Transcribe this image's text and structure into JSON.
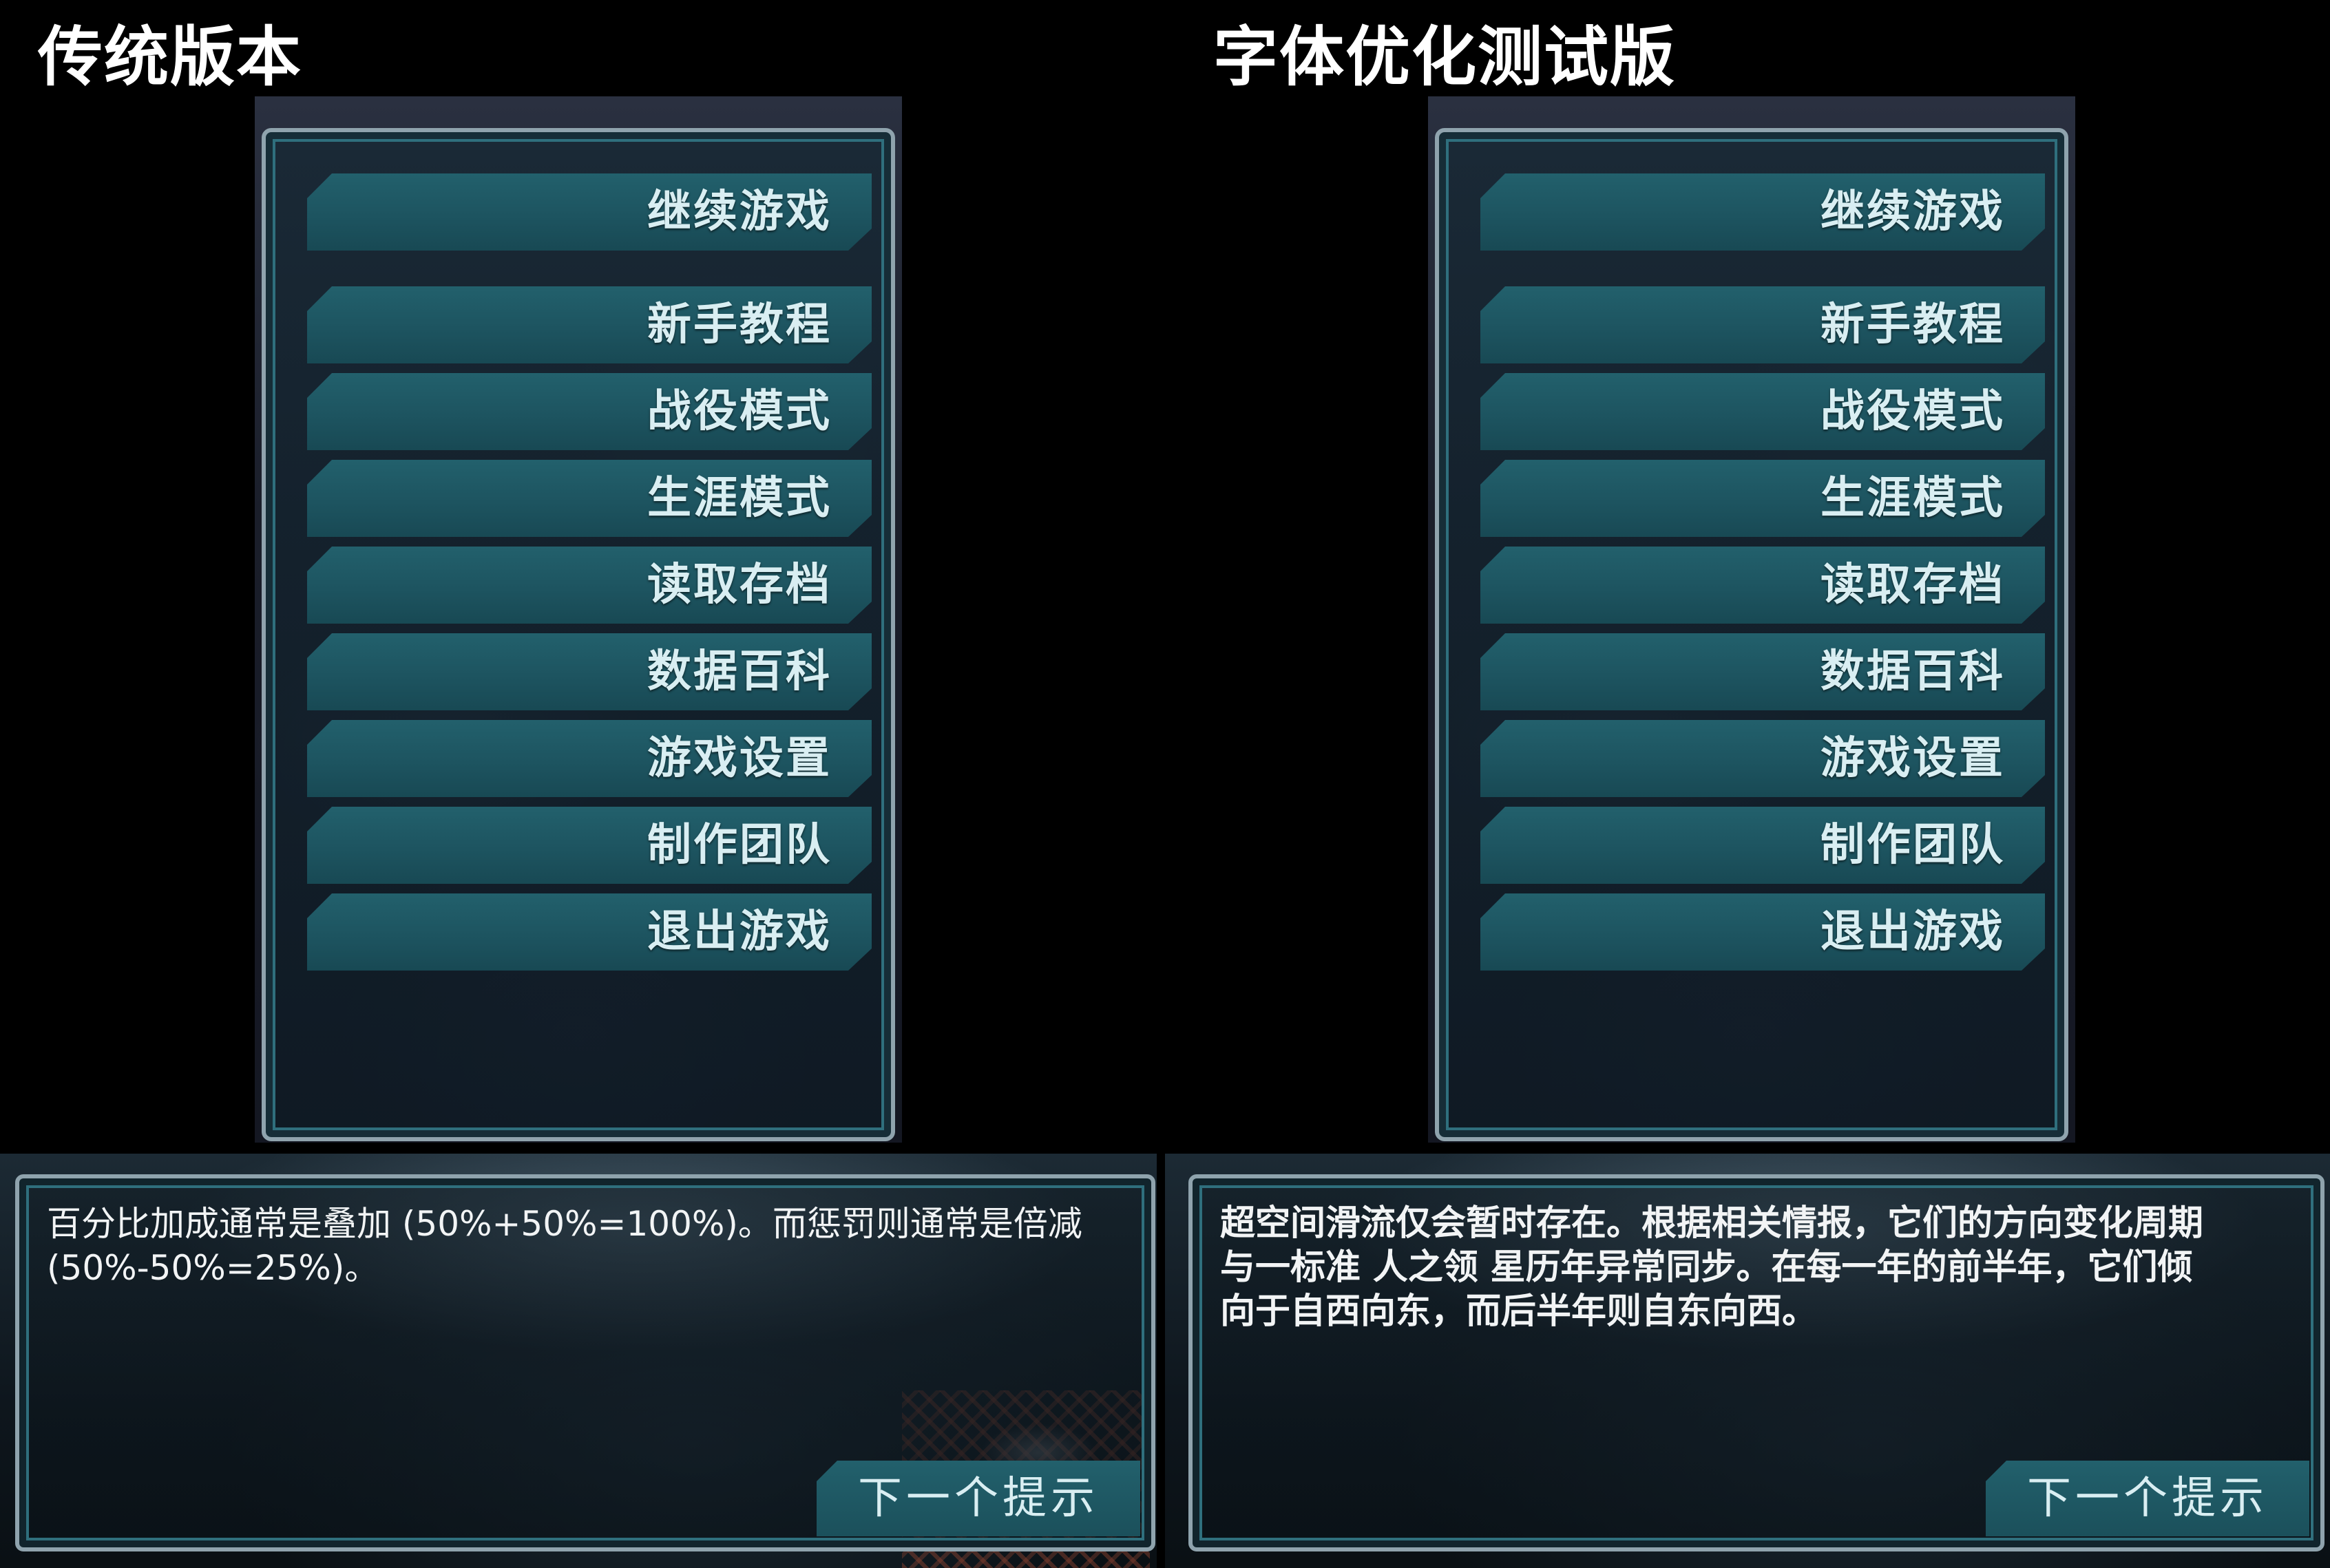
{
  "left": {
    "heading": "传统版本",
    "menu": {
      "items": [
        {
          "label": "继续游戏"
        },
        {
          "label": "新手教程"
        },
        {
          "label": "战役模式"
        },
        {
          "label": "生涯模式"
        },
        {
          "label": "读取存档"
        },
        {
          "label": "数据百科"
        },
        {
          "label": "游戏设置"
        },
        {
          "label": "制作团队"
        },
        {
          "label": "退出游戏"
        }
      ]
    },
    "tip": {
      "text": "百分比加成通常是叠加 (50%+50%=100%)。而惩罚则通常是倍减\n(50%-50%=25%)。",
      "next_label": "下一个提示"
    }
  },
  "right": {
    "heading": "字体优化测试版",
    "menu": {
      "items": [
        {
          "label": "继续游戏"
        },
        {
          "label": "新手教程"
        },
        {
          "label": "战役模式"
        },
        {
          "label": "生涯模式"
        },
        {
          "label": "读取存档"
        },
        {
          "label": "数据百科"
        },
        {
          "label": "游戏设置"
        },
        {
          "label": "制作团队"
        },
        {
          "label": "退出游戏"
        }
      ]
    },
    "tip": {
      "text": "超空间滑流仅会暂时存在。根据相关情报，它们的方向变化周期\n与一标准 人之领 星历年异常同步。在每一年的前半年，它们倾\n向于自西向东，而后半年则自东向西。",
      "next_label": "下一个提示"
    }
  },
  "colors": {
    "button_fill": "#1d5460",
    "button_text": "#d9eef2",
    "frame_border": "#8fa3ad",
    "frame_inner_line": "#2f6f7d",
    "tip_text": "#f2f4f5"
  }
}
